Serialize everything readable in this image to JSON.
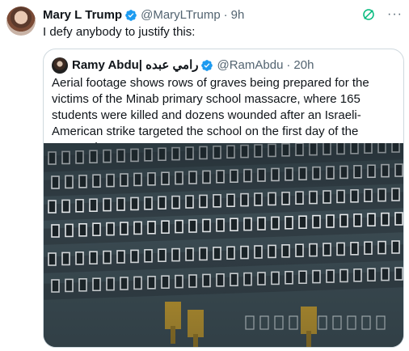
{
  "tweet": {
    "display_name": "Mary L Trump",
    "handle": "@MaryLTrump",
    "separator": "·",
    "time": "9h",
    "text": "I defy anybody to justify this:",
    "more_label": "···"
  },
  "quote": {
    "display_name": "Ramy Abdu| رامي عبده",
    "handle": "@RamAbdu",
    "separator": "·",
    "time": "20h",
    "text": "Aerial footage shows rows of graves being prepared for the victims of the Minab primary school massacre, where 165 students were killed and dozens wounded after an Israeli-American strike targeted the school on the first day of the aggression."
  },
  "colors": {
    "verified": "#1d9bf0",
    "grok": "#00ba7c",
    "secondary_text": "#536471",
    "border": "#cfd9de",
    "ground": "#3b4b52",
    "grave": "#e9ecee",
    "dirt": "#2a3338",
    "excavator": "#c59a2a"
  },
  "icons": [
    "verified-badge-icon",
    "grok-icon",
    "more-icon"
  ]
}
